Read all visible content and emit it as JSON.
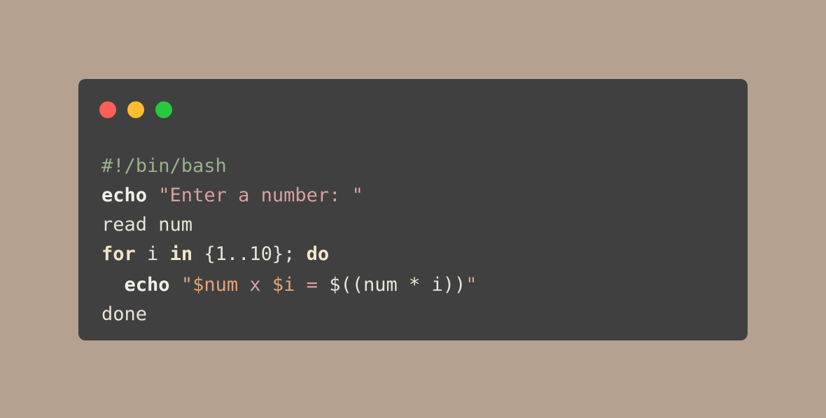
{
  "window": {
    "traffic_lights": {
      "close_color": "#ff5f56",
      "minimize_color": "#ffbd2e",
      "maximize_color": "#27c93f"
    }
  },
  "code": {
    "language": "bash",
    "lines": [
      {
        "tokens": [
          {
            "text": "#!/bin/bash",
            "type": "comment"
          }
        ]
      },
      {
        "tokens": [
          {
            "text": "echo",
            "type": "builtin"
          },
          {
            "text": " ",
            "type": "plain"
          },
          {
            "text": "\"Enter a number: \"",
            "type": "string"
          }
        ]
      },
      {
        "tokens": [
          {
            "text": "read num",
            "type": "plain"
          }
        ]
      },
      {
        "tokens": [
          {
            "text": "for",
            "type": "keyword"
          },
          {
            "text": " i ",
            "type": "plain"
          },
          {
            "text": "in",
            "type": "keyword"
          },
          {
            "text": " {1..10}; ",
            "type": "plain"
          },
          {
            "text": "do",
            "type": "keyword"
          }
        ]
      },
      {
        "tokens": [
          {
            "text": "  ",
            "type": "plain"
          },
          {
            "text": "echo",
            "type": "builtin"
          },
          {
            "text": " ",
            "type": "plain"
          },
          {
            "text": "\"",
            "type": "string"
          },
          {
            "text": "$num",
            "type": "var"
          },
          {
            "text": " x ",
            "type": "string"
          },
          {
            "text": "$i",
            "type": "var"
          },
          {
            "text": " = ",
            "type": "string"
          },
          {
            "text": "$((num * i))",
            "type": "plain"
          },
          {
            "text": "\"",
            "type": "string"
          }
        ]
      },
      {
        "tokens": [
          {
            "text": "done",
            "type": "plain"
          }
        ]
      }
    ]
  }
}
